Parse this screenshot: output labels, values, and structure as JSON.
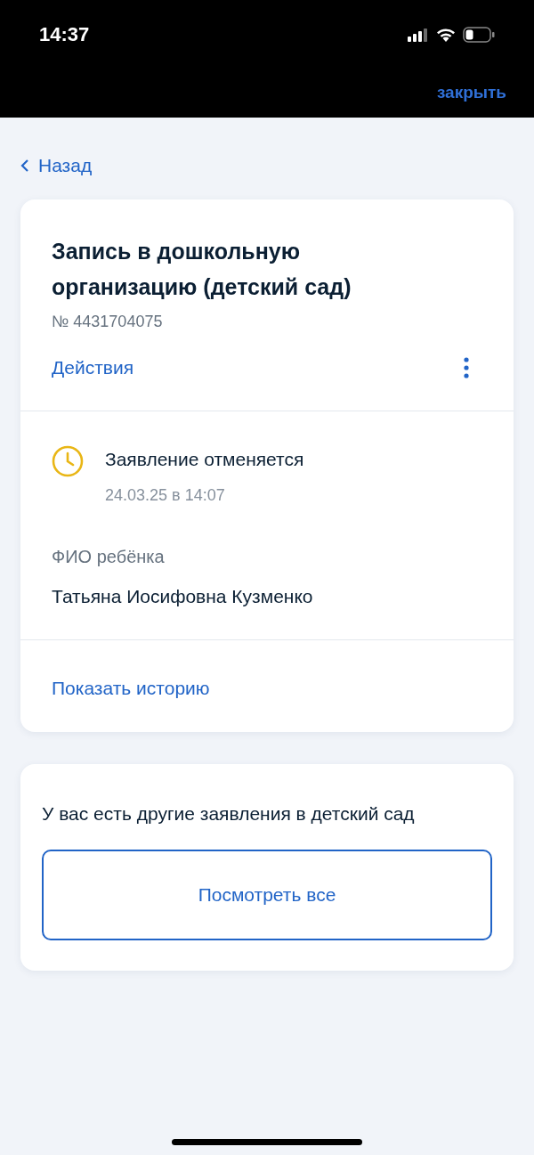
{
  "status_bar": {
    "time": "14:37"
  },
  "top_bar": {
    "close_link": "закрыть"
  },
  "back_link": "Назад",
  "application_card": {
    "title": "Запись в дошкольную организацию (детский сад)",
    "number": "№ 4431704075",
    "actions_link": "Действия",
    "status": {
      "text": "Заявление отменяется",
      "date": "24.03.25 в 14:07",
      "color": "#e9b615"
    },
    "child_label": "ФИО ребёнка",
    "child_name": "Татьяна Иосифовна Кузменко",
    "history_link": "Показать историю"
  },
  "other_card": {
    "text": "У вас есть другие заявления в детский сад",
    "button": "Посмотреть все"
  }
}
